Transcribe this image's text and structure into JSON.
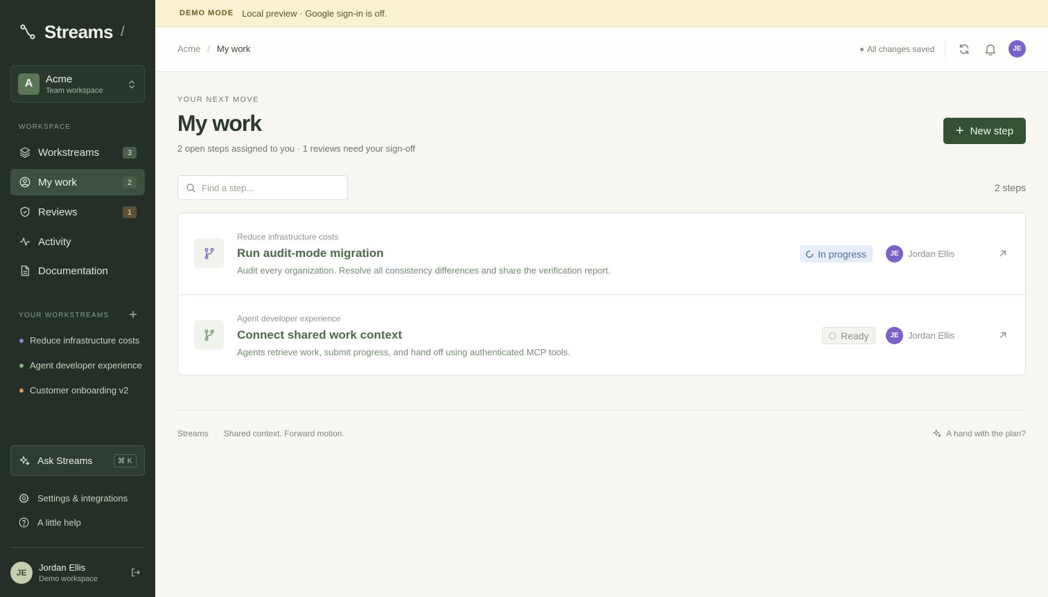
{
  "sidebar": {
    "brand": {
      "name": "Streams",
      "slash": "/"
    },
    "workspace": {
      "initial": "A",
      "name": "Acme",
      "subtitle": "Team workspace"
    },
    "section_label": "WORKSPACE",
    "nav": [
      {
        "label": "Workstreams",
        "badge": "3",
        "icon": "layers-icon"
      },
      {
        "label": "My work",
        "badge": "2",
        "icon": "user-circle-icon",
        "active": true
      },
      {
        "label": "Reviews",
        "badge": "1",
        "icon": "shield-check-icon"
      },
      {
        "label": "Activity",
        "badge": "",
        "icon": "activity-icon"
      },
      {
        "label": "Documentation",
        "badge": "",
        "icon": "document-icon"
      }
    ],
    "workstreams_label": "YOUR WORKSTREAMS",
    "workstreams": [
      {
        "label": "Reduce infrastructure costs",
        "color": "#8f86d6"
      },
      {
        "label": "Agent developer experience",
        "color": "#7fb27b"
      },
      {
        "label": "Customer onboarding v2",
        "color": "#d99a5b"
      }
    ],
    "ask": {
      "label": "Ask Streams",
      "shortcut": "⌘ K"
    },
    "settings_label": "Settings & integrations",
    "help_label": "A little help",
    "user": {
      "initials": "JE",
      "name": "Jordan Ellis",
      "subtitle": "Demo workspace"
    }
  },
  "banner": {
    "tag": "DEMO MODE",
    "text": "Local preview · Google sign-in is off."
  },
  "topbar": {
    "breadcrumb_root": "Acme",
    "breadcrumb_sep": "/",
    "breadcrumb_current": "My work",
    "saved_text": "All changes saved",
    "avatar_initials": "JE"
  },
  "main": {
    "eyebrow": "YOUR NEXT MOVE",
    "title": "My work",
    "subtitle": "2 open steps assigned to you · 1 reviews need your sign-off",
    "new_step_label": "New step",
    "search_placeholder": "Find a step...",
    "count": "2 steps",
    "steps": [
      {
        "parent": "Reduce infrastructure costs",
        "title": "Run audit-mode migration",
        "description": "Audit every organization. Resolve all consistency differences and share the verification report.",
        "status": "In progress",
        "assignee_initials": "JE",
        "assignee": "Jordan Ellis",
        "icon_color": "#7b6fc9"
      },
      {
        "parent": "Agent developer experience",
        "title": "Connect shared work context",
        "description": "Agents retrieve work, submit progress, and hand off using authenticated MCP tools.",
        "status": "Ready",
        "assignee_initials": "JE",
        "assignee": "Jordan Ellis",
        "icon_color": "#6f9a6c"
      }
    ]
  },
  "footer": {
    "brand": "Streams",
    "sep": "·",
    "tagline": "Shared context. Forward motion.",
    "help": "A hand with the plan?"
  }
}
